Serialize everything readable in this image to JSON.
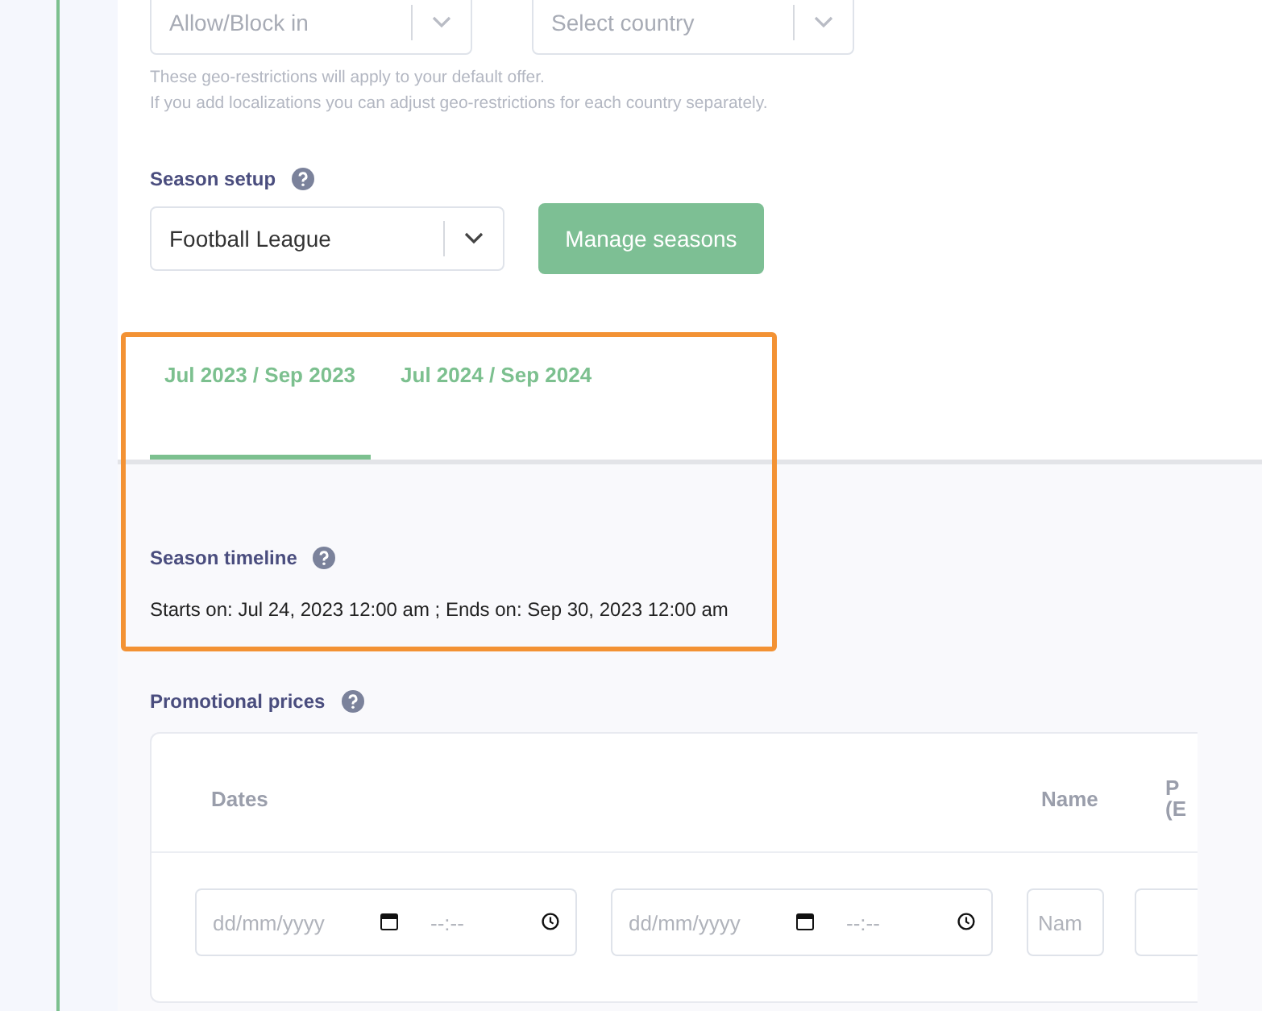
{
  "geo_restrictions": {
    "mode_select": {
      "placeholder": "Allow/Block in"
    },
    "country_select": {
      "placeholder": "Select country"
    },
    "hint_lines": [
      "These geo-restrictions will apply to your default offer.",
      "If you add localizations you can adjust geo-restrictions for each country separately."
    ]
  },
  "season_setup": {
    "label": "Season setup",
    "select": {
      "value": "Football League"
    },
    "manage_button": "Manage seasons"
  },
  "season_tabs": [
    {
      "label": "Jul 2023 / Sep 2023",
      "selected": true
    },
    {
      "label": "Jul 2024 / Sep 2024",
      "selected": false
    }
  ],
  "season_timeline": {
    "label": "Season timeline",
    "text": "Starts on: Jul 24, 2023 12:00 am ; Ends on: Sep 30, 2023 12:00 am"
  },
  "promotional_prices": {
    "label": "Promotional prices",
    "columns": [
      [
        "Dates"
      ],
      [
        "Name"
      ],
      [
        "P",
        "(E"
      ]
    ],
    "row": {
      "start_date": {
        "placeholder": "dd/mm/yyyy"
      },
      "start_time": {
        "placeholder": "--:--"
      },
      "end_date": {
        "placeholder": "dd/mm/yyyy"
      },
      "end_time": {
        "placeholder": "--:--"
      },
      "name": {
        "placeholder": "Nam"
      }
    }
  },
  "annotation": {
    "kind": "highlight",
    "color": "#f39234"
  }
}
